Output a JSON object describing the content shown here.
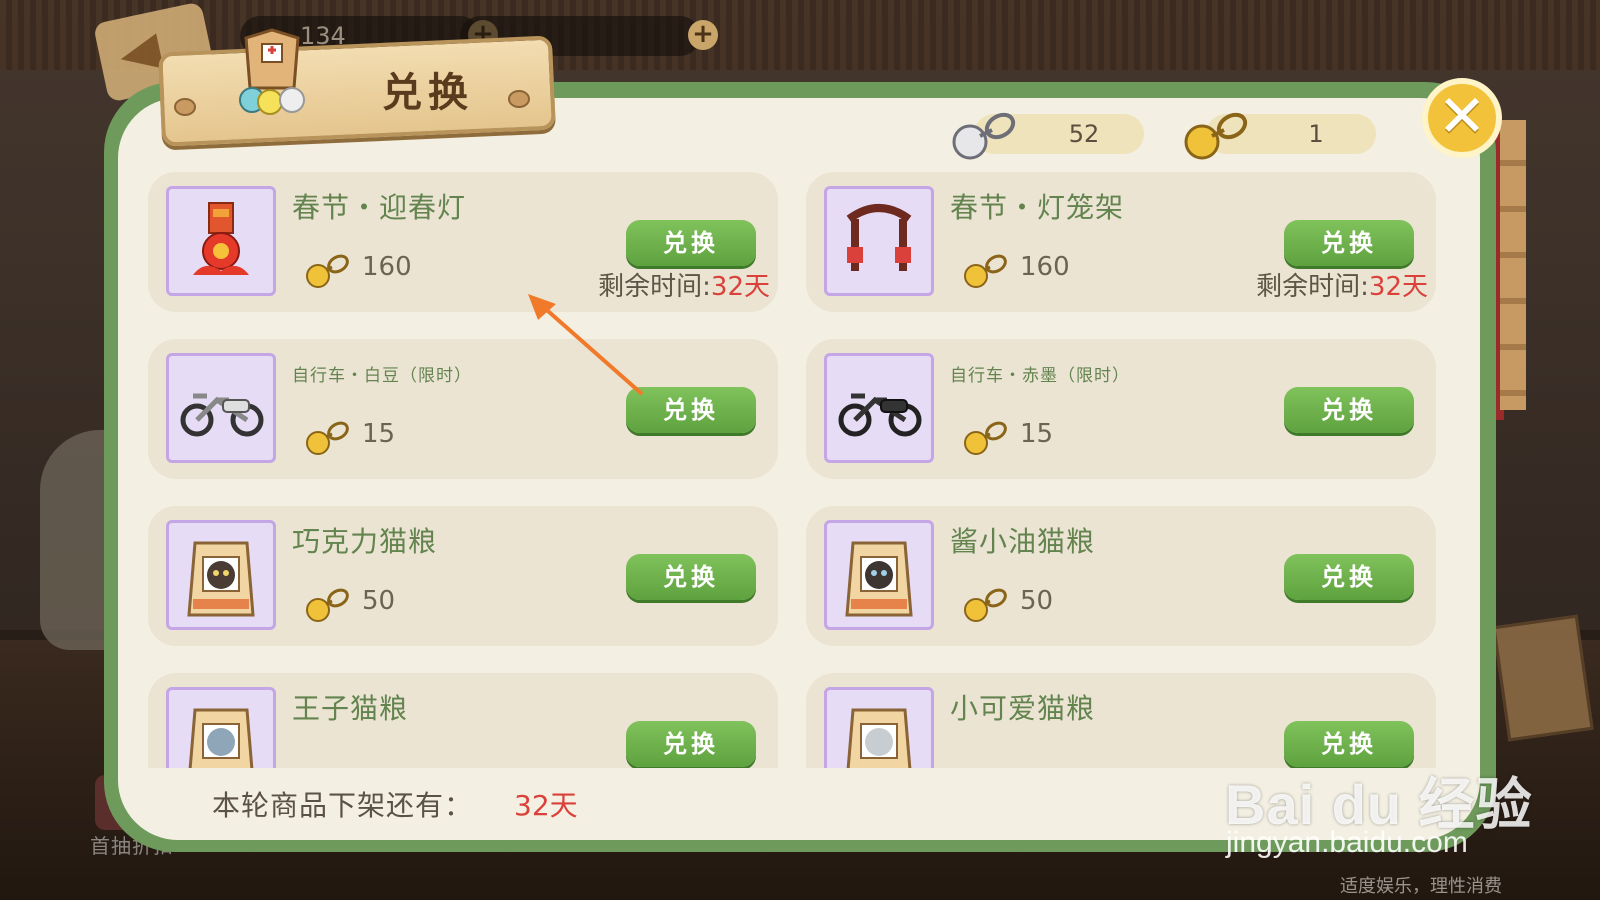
{
  "title": "兑换",
  "close_label": "✕",
  "currencies": [
    {
      "icon": "silver-key-coin-icon",
      "value": "52"
    },
    {
      "icon": "gold-key-coin-icon",
      "value": "1"
    }
  ],
  "top_resources": [
    {
      "value": "134"
    },
    {
      "value": ""
    }
  ],
  "items": [
    {
      "name": "春节・迎春灯",
      "price": "160",
      "button": "兑换",
      "remain_label": "剩余时间:",
      "remain_value": "32天",
      "icon": "lantern-icon"
    },
    {
      "name": "春节・灯笼架",
      "price": "160",
      "button": "兑换",
      "remain_label": "剩余时间:",
      "remain_value": "32天",
      "icon": "lantern-rack-icon"
    },
    {
      "name": "自行车・白豆（限时）",
      "price": "15",
      "button": "兑换",
      "icon": "bicycle-icon"
    },
    {
      "name": "自行车・赤墨（限时）",
      "price": "15",
      "button": "兑换",
      "icon": "bicycle-icon"
    },
    {
      "name": "巧克力猫粮",
      "price": "50",
      "button": "兑换",
      "icon": "cat-food-bag-icon"
    },
    {
      "name": "酱小油猫粮",
      "price": "50",
      "button": "兑换",
      "icon": "cat-food-bag-icon"
    },
    {
      "name": "王子猫粮",
      "price": "",
      "button": "兑换",
      "icon": "cat-food-bag-icon"
    },
    {
      "name": "小可爱猫粮",
      "price": "",
      "button": "兑换",
      "icon": "cat-food-bag-icon"
    }
  ],
  "footer": {
    "label": "本轮商品下架还有：",
    "value": "32天"
  },
  "first_draw_label": "首抽折扣",
  "watermark": {
    "brand": "Bai du 经验",
    "url": "jingyan.baidu.com"
  },
  "footer_note": "适度娱乐，理性消费",
  "colors": {
    "accent_green": "#5ea23f",
    "frame_green": "#6e9a5b",
    "highlight_red": "#d9413a",
    "gold": "#f2c23a"
  }
}
